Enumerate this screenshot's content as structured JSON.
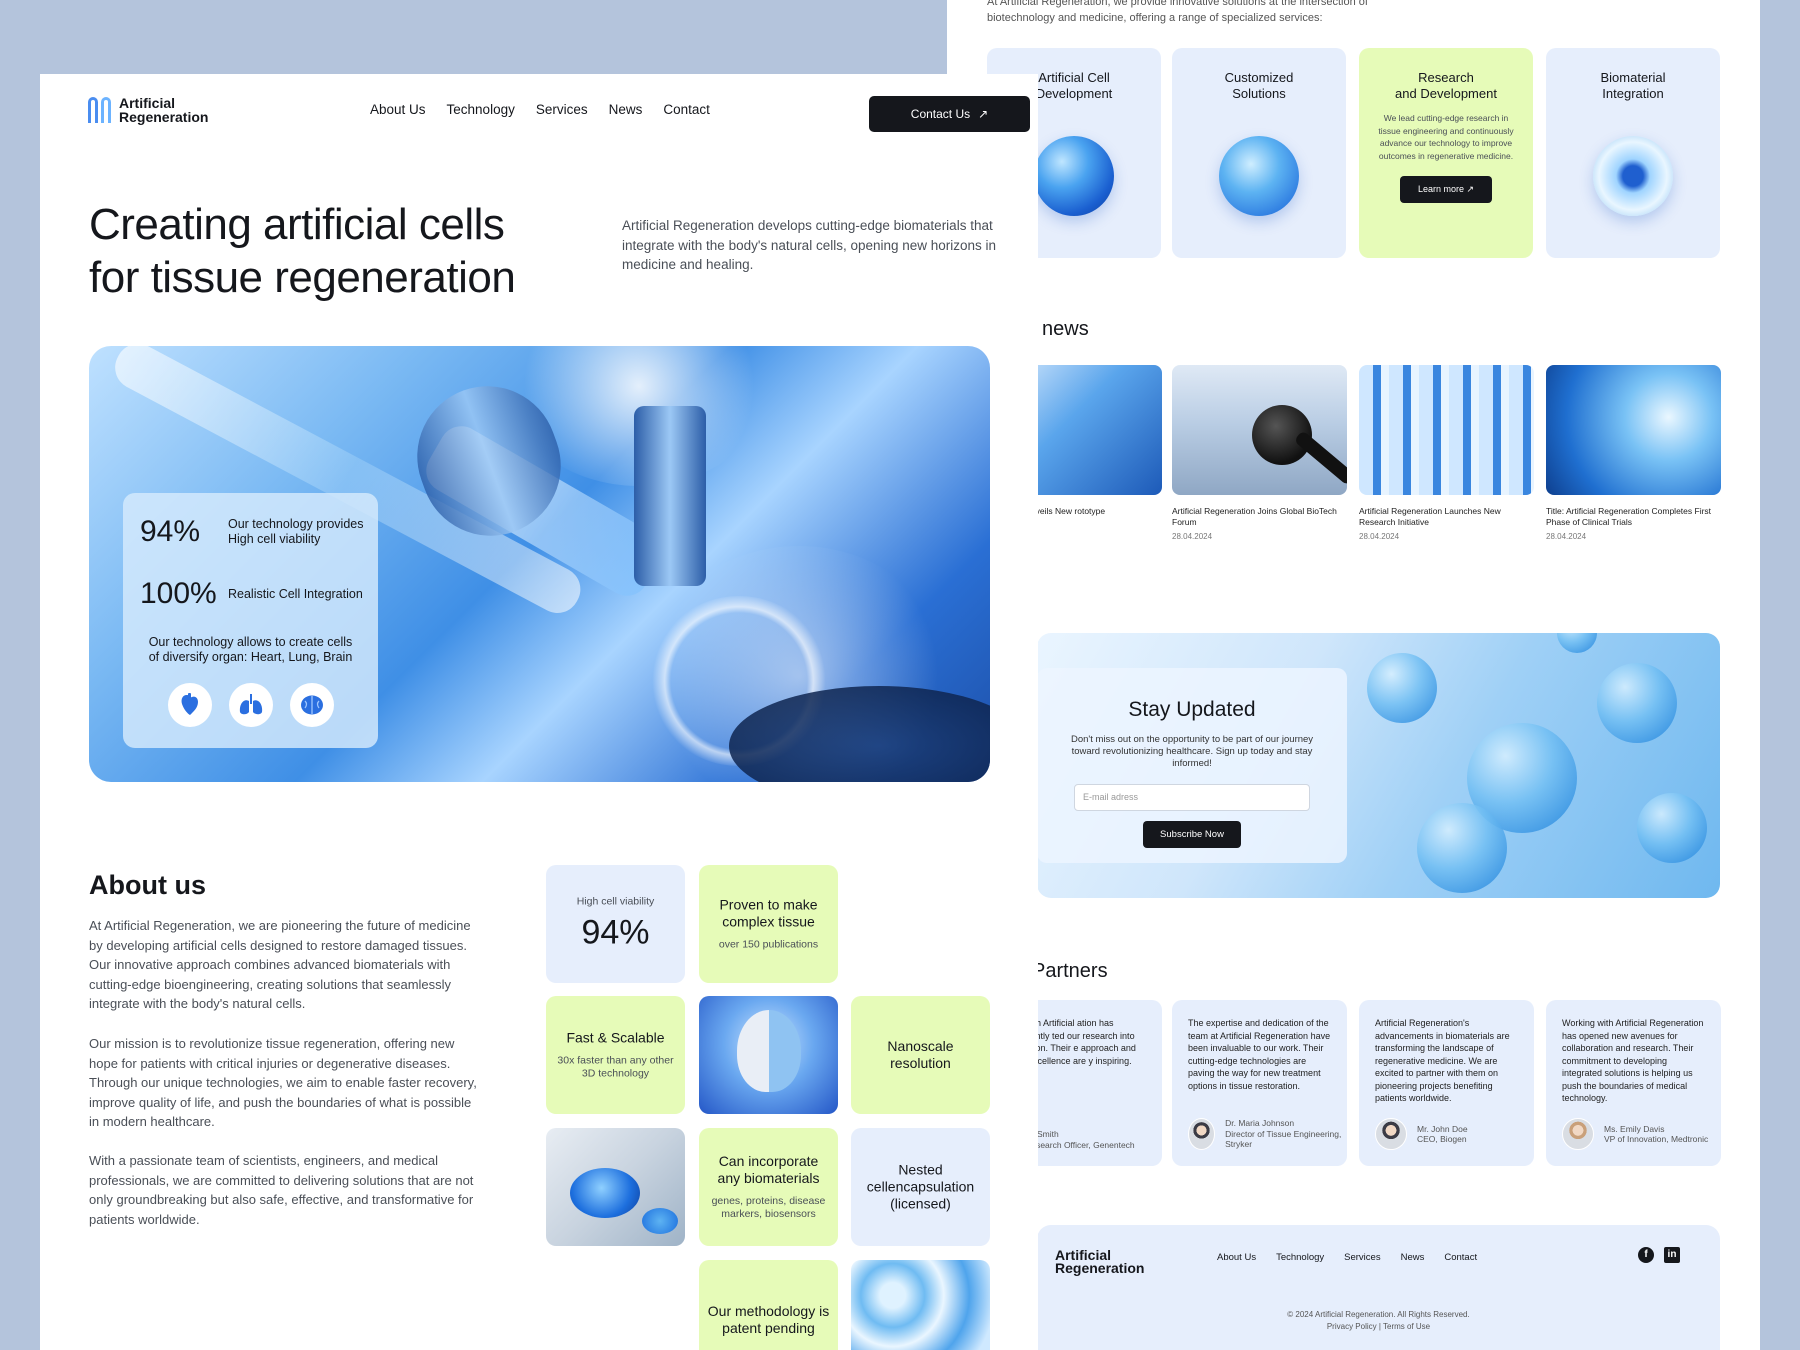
{
  "back": {
    "intro": "At Artificial Regeneration, we provide innovative solutions at the intersection of biotechnology and medicine, offering a range of specialized services:",
    "services": [
      {
        "title": "Artificial Cell\nDevelopment",
        "text": "",
        "button": ""
      },
      {
        "title": "Customized\nSolutions",
        "text": "",
        "button": ""
      },
      {
        "title": "Research\nand Development",
        "text": "We lead cutting-edge research in tissue engineering and continuously advance our technology to improve outcomes in regenerative medicine.",
        "button": "Learn more ↗"
      },
      {
        "title": "Biomaterial\nIntegration",
        "text": "",
        "button": ""
      }
    ],
    "news_heading": "news",
    "news": [
      {
        "title": "eneration Unveils New rototype",
        "date": ""
      },
      {
        "title": "Artificial Regeneration Joins Global BioTech Forum",
        "date": "28.04.2024"
      },
      {
        "title": "Artificial Regeneration Launches New Research Initiative",
        "date": "28.04.2024"
      },
      {
        "title": "Title: Artificial Regeneration Completes First Phase of Clinical Trials",
        "date": "28.04.2024"
      }
    ],
    "subscribe": {
      "title": "Stay Updated",
      "text": "Don't miss out on the opportunity to be part of our journey toward revolutionizing healthcare. Sign up today and stay informed!",
      "placeholder": "E-mail adress",
      "button": "Subscribe Now"
    },
    "partners_heading": "Partners",
    "testimonials": [
      {
        "quote": "ating with Artificial ation has significantly ted our research into generation. Their e approach and ent to excellence are y inspiring.",
        "name": "Dr. Jane Smith",
        "role": "Chief Research Officer, Genentech"
      },
      {
        "quote": "The expertise and dedication of the team at Artificial Regeneration have been invaluable to our work. Their cutting-edge technologies are paving the way for new treatment options in tissue restoration.",
        "name": "Dr. Maria Johnson",
        "role": "Director of Tissue Engineering, Stryker"
      },
      {
        "quote": "Artificial Regeneration's advancements in biomaterials are transforming the landscape of regenerative medicine. We are excited to partner with them on pioneering projects benefiting patients worldwide.",
        "name": "Mr. John Doe",
        "role": "CEO, Biogen"
      },
      {
        "quote": "Working with Artificial Regeneration has opened new avenues for collaboration and research. Their commitment to developing integrated solutions is helping us push the boundaries of medical technology.",
        "name": "Ms. Emily Davis",
        "role": "VP of Innovation, Medtronic"
      }
    ],
    "footer": {
      "logo_line1": "Artificial",
      "logo_line2": "Regeneration",
      "nav": [
        "About Us",
        "Technology",
        "Services",
        "News",
        "Contact"
      ],
      "copyright": "© 2024 Artificial Regeneration. All Rights Reserved.",
      "legal": "Privacy Policy | Terms of Use"
    }
  },
  "front": {
    "logo_line1": "Artificial",
    "logo_line2": "Regeneration",
    "nav": [
      "About Us",
      "Technology",
      "Services",
      "News",
      "Contact"
    ],
    "cta": "Contact Us",
    "hero_title_line1": "Creating artificial cells",
    "hero_title_line2": "for tissue regeneration",
    "hero_subtitle": "Artificial Regeneration develops cutting-edge biomaterials that integrate with the body's natural cells, opening new horizons in medicine and healing.",
    "stats": [
      {
        "value": "94%",
        "label": "Our technology provides High cell viability"
      },
      {
        "value": "100%",
        "label": "Realistic Cell Integration"
      }
    ],
    "stats_desc": "Our technology allows to create cells of diversify organ: Heart, Lung, Brain",
    "organ_icons": [
      "heart-icon",
      "lungs-icon",
      "brain-icon"
    ],
    "about_heading": "About us",
    "about_paragraphs": [
      "At Artificial Regeneration, we are pioneering the future of medicine by developing artificial cells designed to restore damaged tissues. Our innovative approach combines advanced biomaterials with cutting-edge bioengineering, creating solutions that seamlessly integrate with the body's natural cells.",
      "Our mission is to revolutionize tissue regeneration, offering new hope for patients with critical injuries or degenerative diseases. Through our unique technologies, we aim to enable faster recovery, improve quality of life, and push the boundaries of what is possible in modern healthcare.",
      "With a passionate team of scientists, engineers, and medical professionals, we are committed to delivering solutions that are not only groundbreaking but also safe, effective, and transformative for patients worldwide."
    ],
    "tiles": {
      "viability_label": "High cell viability",
      "viability_value": "94%",
      "proven_title": "Proven to make complex tissue",
      "proven_sub": "over 150 publications",
      "fast_title": "Fast & Scalable",
      "fast_sub": "30x faster than any other 3D technology",
      "nano_title": "Nanoscale resolution",
      "biomat_title": "Can incorporate any biomaterials",
      "biomat_sub": "genes, proteins, disease markers, biosensors",
      "nested_title": "Nested cellencapsulation (licensed)",
      "method_title": "Our methodology is patent pending"
    }
  },
  "colors": {
    "accent_green": "#e6fbb8",
    "accent_blue": "#e6eefc",
    "dark": "#15171c",
    "backdrop": "#b4c4dc"
  }
}
